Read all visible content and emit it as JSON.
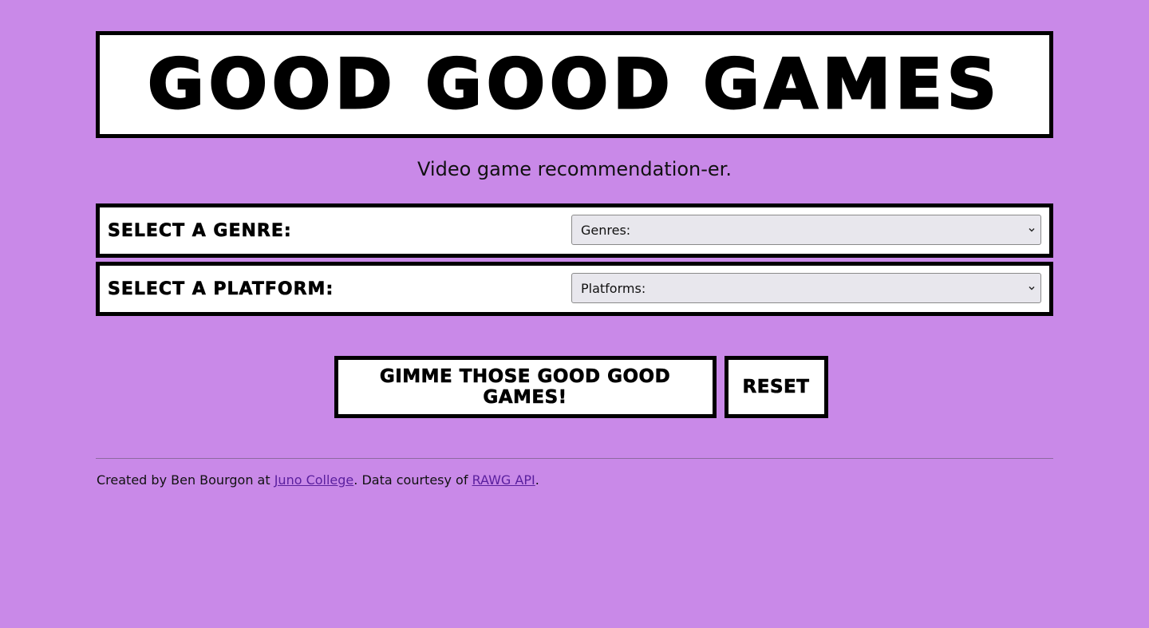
{
  "header": {
    "title": "GOOD GOOD GAMES",
    "subtitle": "Video game recommendation-er."
  },
  "filters": {
    "genre": {
      "label": "SELECT A GENRE:",
      "selected": "Genres:"
    },
    "platform": {
      "label": "SELECT A PLATFORM:",
      "selected": "Platforms:"
    }
  },
  "actions": {
    "submit_label": "GIMME THOSE GOOD GOOD GAMES!",
    "reset_label": "RESET"
  },
  "footer": {
    "prefix": "Created by Ben Bourgon at ",
    "college_link": "Juno College",
    "middle": ". Data courtesy of ",
    "api_link": "RAWG API",
    "suffix": "."
  },
  "colors": {
    "background": "#c989e8",
    "panel": "#ffffff",
    "border": "#000000",
    "select_bg": "#e8e7ed",
    "link": "#5a1f9e"
  },
  "icons": {
    "select_arrow": "chevron-down-icon"
  }
}
